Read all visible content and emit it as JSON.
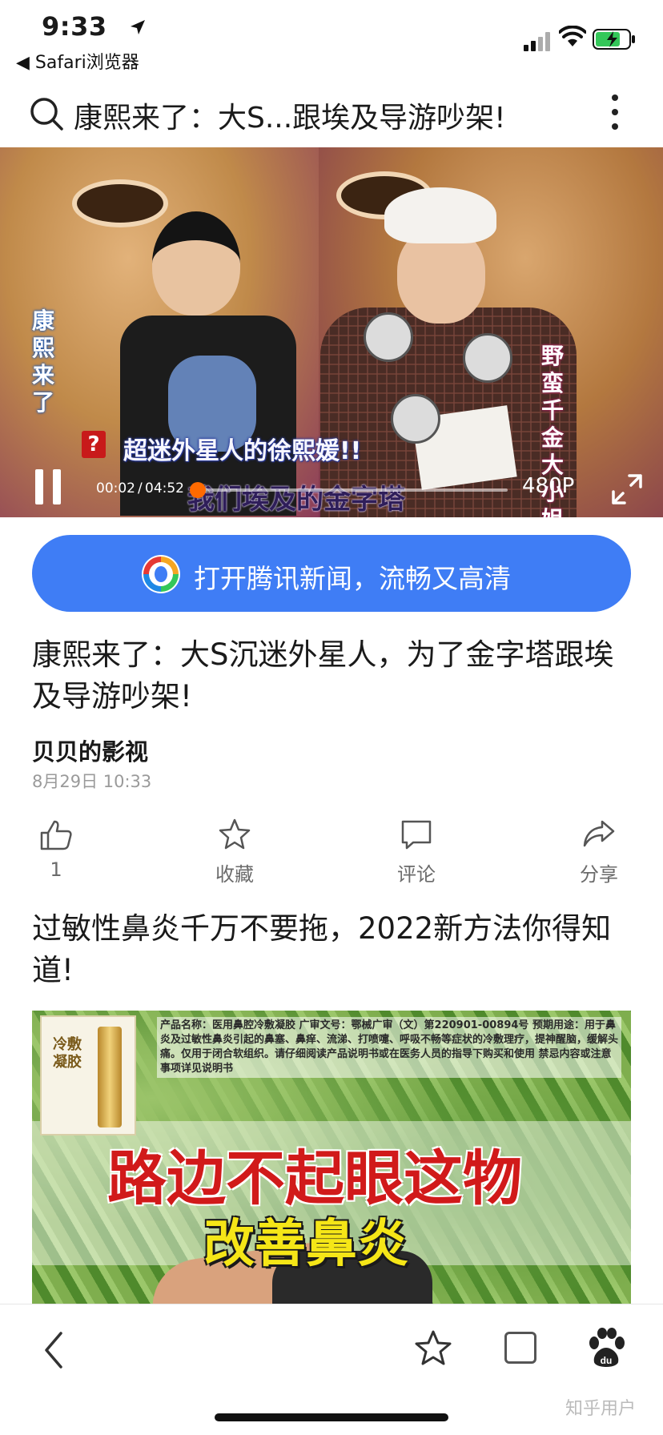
{
  "status_bar": {
    "time": "9:33",
    "back_app": "◀ Safari浏览器"
  },
  "header": {
    "title": "康熙来了：大S...跟埃及导游吵架!"
  },
  "video": {
    "overlay_left": "康熙来了",
    "overlay_right": "野蛮千金大小姐",
    "caption_icon": "?",
    "caption_line1": "超迷外星人的徐熙媛!!",
    "caption_line2": "我们埃及的金字塔",
    "current_time": "00:02",
    "separator": "/",
    "total_time": "04:52",
    "progress": 0.007,
    "quality": "480P"
  },
  "open_app_banner": {
    "text": "打开腾讯新闻，流畅又高清",
    "color": "#3f7df5"
  },
  "article": {
    "title": "康熙来了：大S沉迷外星人，为了金字塔跟埃及导游吵架!",
    "author": "贝贝的影视",
    "date": "8月29日 10:33"
  },
  "actions": {
    "like_count": "1",
    "favorite_label": "收藏",
    "comment_label": "评论",
    "share_label": "分享"
  },
  "ad": {
    "title": "过敏性鼻炎千万不要拖，2022新方法你得知道!",
    "product_text": "冷敷凝胶",
    "description": "产品名称：医用鼻腔冷敷凝胶 广审文号：鄂械广审（文）第220901-00894号 预期用途：用于鼻炎及过敏性鼻炎引起的鼻塞、鼻痒、流涕、打喷嚏、呼吸不畅等症状的冷敷理疗，提神醒脑，缓解头痛。仅用于闭合软组织。请仔细阅读产品说明书或在医务人员的指导下购买和使用 禁忌内容或注意事项详见说明书",
    "headline_1": "路边不起眼这物",
    "headline_2": "改善鼻炎"
  },
  "watermark": "知乎用户"
}
